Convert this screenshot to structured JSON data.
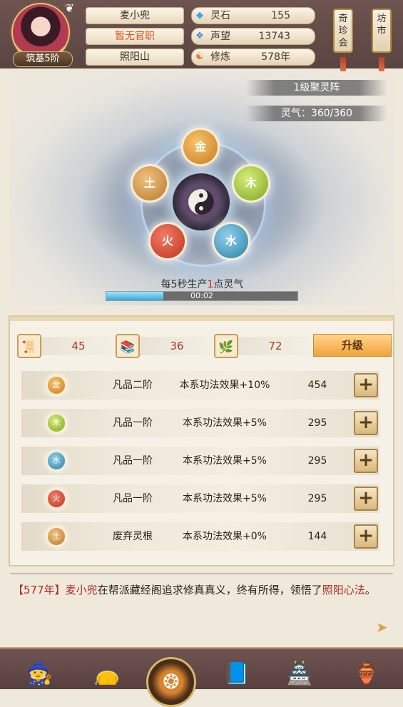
{
  "player": {
    "name": "麦小兜",
    "title": "暂无官职",
    "location": "照阳山",
    "realm": "筑基5阶"
  },
  "stats": [
    {
      "icon": "spirit-stone-icon",
      "label": "灵石",
      "value": "155"
    },
    {
      "icon": "reputation-icon",
      "label": "声望",
      "value": "13743"
    },
    {
      "icon": "cultivation-icon",
      "label": "修炼",
      "value": "578年"
    }
  ],
  "side_buttons": {
    "treasure": "奇珍会",
    "market": "坊市"
  },
  "formation": {
    "level": "1级聚灵阵",
    "qi_label": "灵气：",
    "qi_value": "360/360",
    "production_prefix": "每5秒生产",
    "production_num": "1",
    "production_suffix": "点灵气",
    "timer": "00:02",
    "progress": 0.3,
    "elements": {
      "gold": "金",
      "wood": "木",
      "water": "水",
      "fire": "火",
      "earth": "土"
    }
  },
  "resources": [
    {
      "icon": "scroll-icon",
      "value": "45"
    },
    {
      "icon": "book-stack-icon",
      "value": "36"
    },
    {
      "icon": "herb-icon",
      "value": "72"
    }
  ],
  "upgrade_label": "升级",
  "roots": [
    {
      "element": "金",
      "grade": "凡品二阶",
      "effect": "本系功法效果+10%",
      "cost": "454"
    },
    {
      "element": "木",
      "grade": "凡品一阶",
      "effect": "本系功法效果+5%",
      "cost": "295"
    },
    {
      "element": "水",
      "grade": "凡品一阶",
      "effect": "本系功法效果+5%",
      "cost": "295"
    },
    {
      "element": "火",
      "grade": "凡品一阶",
      "effect": "本系功法效果+5%",
      "cost": "295"
    },
    {
      "element": "土",
      "grade": "废弃灵根",
      "effect": "本系功法效果+0%",
      "cost": "144"
    }
  ],
  "plus_label": "+",
  "log": {
    "open": "【",
    "year": "577年",
    "close": "】",
    "name": "麦小兜",
    "text": "在帮派藏经阁追求修真真义，终有所得，领悟了",
    "skill": "照阳心法",
    "end": "。"
  },
  "colors": {
    "accent": "#f0a33b",
    "highlight": "#b2281d",
    "header": "#5a4442"
  }
}
